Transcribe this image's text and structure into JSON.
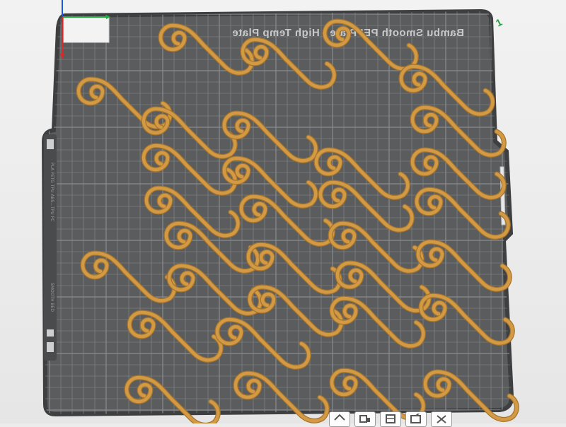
{
  "plate": {
    "name": "Bambu Smooth PEI Plate / High Temp Plate",
    "number_badge": "1",
    "side_label": "PLA PETG TPU ABS...TPU PC",
    "bed_type_label": "SMOOTH BED"
  },
  "colors": {
    "plate_surface": "#5a5c5e",
    "plate_border": "#3e3f41",
    "grid_line": "#8a8c8e",
    "part_fill": "#d29a44",
    "part_outline": "#a8742a",
    "axis_x": "#1eae3a",
    "axis_y": "#1a56d8",
    "axis_z": "#d82a2a"
  },
  "model": {
    "name": "s-hook",
    "rows": 8,
    "columns": 5
  },
  "toolbar": {
    "buttons": [
      {
        "name": "home-view-button",
        "icon": "home-icon"
      },
      {
        "name": "arrange-button",
        "icon": "arrange-icon"
      },
      {
        "name": "orient-button",
        "icon": "orient-icon"
      },
      {
        "name": "slice-plate-button",
        "icon": "slice-icon"
      },
      {
        "name": "close-plate-button",
        "icon": "close-icon"
      }
    ]
  }
}
